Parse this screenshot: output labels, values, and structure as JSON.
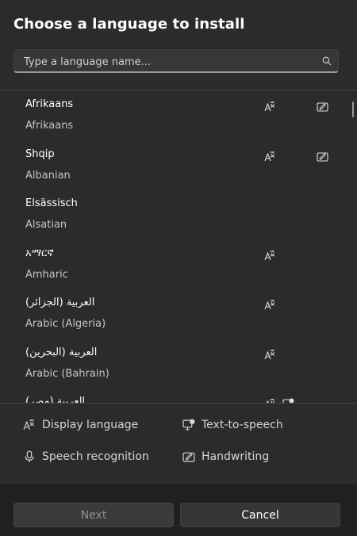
{
  "dialog": {
    "title": "Choose a language to install"
  },
  "search": {
    "placeholder": "Type a language name..."
  },
  "languages": [
    {
      "native": "Afrikaans",
      "english": "Afrikaans",
      "display": true,
      "handwriting": true
    },
    {
      "native": "Shqip",
      "english": "Albanian",
      "display": true,
      "handwriting": true
    },
    {
      "native": "Elsässisch",
      "english": "Alsatian",
      "display": false,
      "handwriting": false
    },
    {
      "native": "አማርኛ",
      "english": "Amharic",
      "display": true,
      "handwriting": false
    },
    {
      "native": "العربية (الجزائر)",
      "english": "Arabic (Algeria)",
      "display": true,
      "handwriting": false
    },
    {
      "native": "العربية (البحرين)",
      "english": "Arabic (Bahrain)",
      "display": true,
      "handwriting": false
    },
    {
      "native": "العربية (مصر)",
      "english": "",
      "display": true,
      "tts": true,
      "handwriting": false
    }
  ],
  "legend": {
    "display_language": "Display language",
    "text_to_speech": "Text-to-speech",
    "speech_recognition": "Speech recognition",
    "handwriting": "Handwriting"
  },
  "footer": {
    "next_label": "Next",
    "cancel_label": "Cancel"
  }
}
